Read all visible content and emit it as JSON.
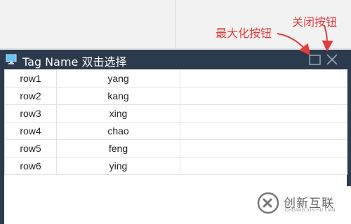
{
  "annotations": {
    "maximize": "最大化按钮",
    "close": "关闭按钮"
  },
  "window": {
    "title": "Tag Name 双击选择",
    "icon": "monitor-icon",
    "max_icon": "maximize-icon",
    "close_icon": "close-icon"
  },
  "table": {
    "rows": [
      [
        "row1",
        "yang",
        ""
      ],
      [
        "row2",
        "kang",
        ""
      ],
      [
        "row3",
        "xing",
        ""
      ],
      [
        "row4",
        "chao",
        ""
      ],
      [
        "row5",
        "feng",
        ""
      ],
      [
        "row6",
        "ying",
        ""
      ]
    ]
  },
  "watermark": {
    "name": "创新互联",
    "subtitle": "CHUANG XIN HU LIAN"
  },
  "colors": {
    "titlebar": "#2b3b4d",
    "annotation": "#e23c3c"
  }
}
